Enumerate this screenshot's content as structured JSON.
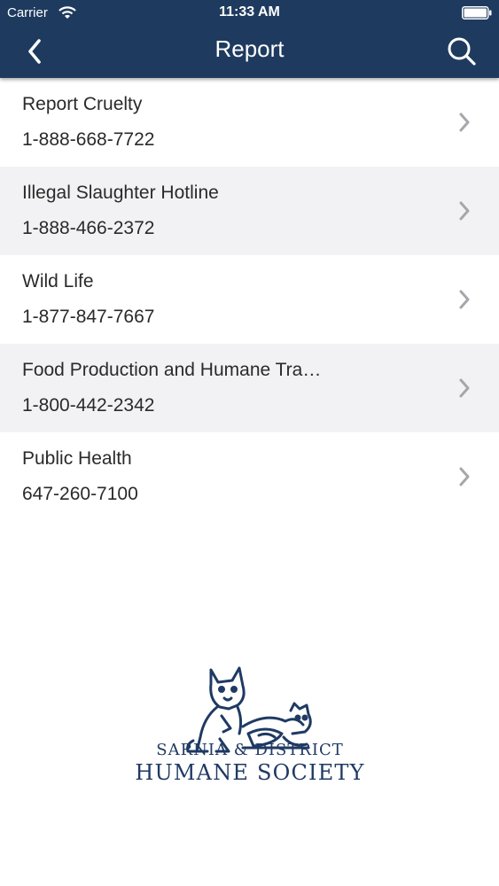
{
  "status_bar": {
    "carrier": "Carrier",
    "time": "11:33 AM"
  },
  "nav": {
    "title": "Report",
    "back_icon": "chevron-left-icon",
    "search_icon": "search-icon"
  },
  "items": [
    {
      "title": "Report Cruelty",
      "phone": "1-888-668-7722"
    },
    {
      "title": "Illegal Slaughter Hotline",
      "phone": "1-888-466-2372"
    },
    {
      "title": "Wild Life",
      "phone": "1-877-847-7667"
    },
    {
      "title": "Food Production and Humane Tra…",
      "phone": "1-800-442-2342"
    },
    {
      "title": "Public Health",
      "phone": "647-260-7100"
    }
  ],
  "logo": {
    "line1": "SARNIA & DISTRICT",
    "line2": "HUMANE SOCIETY"
  },
  "colors": {
    "navbar": "#1e3b5f",
    "row_alt": "#f2f2f4",
    "logo": "#1f3a63",
    "chevron": "#a6a6ab"
  }
}
